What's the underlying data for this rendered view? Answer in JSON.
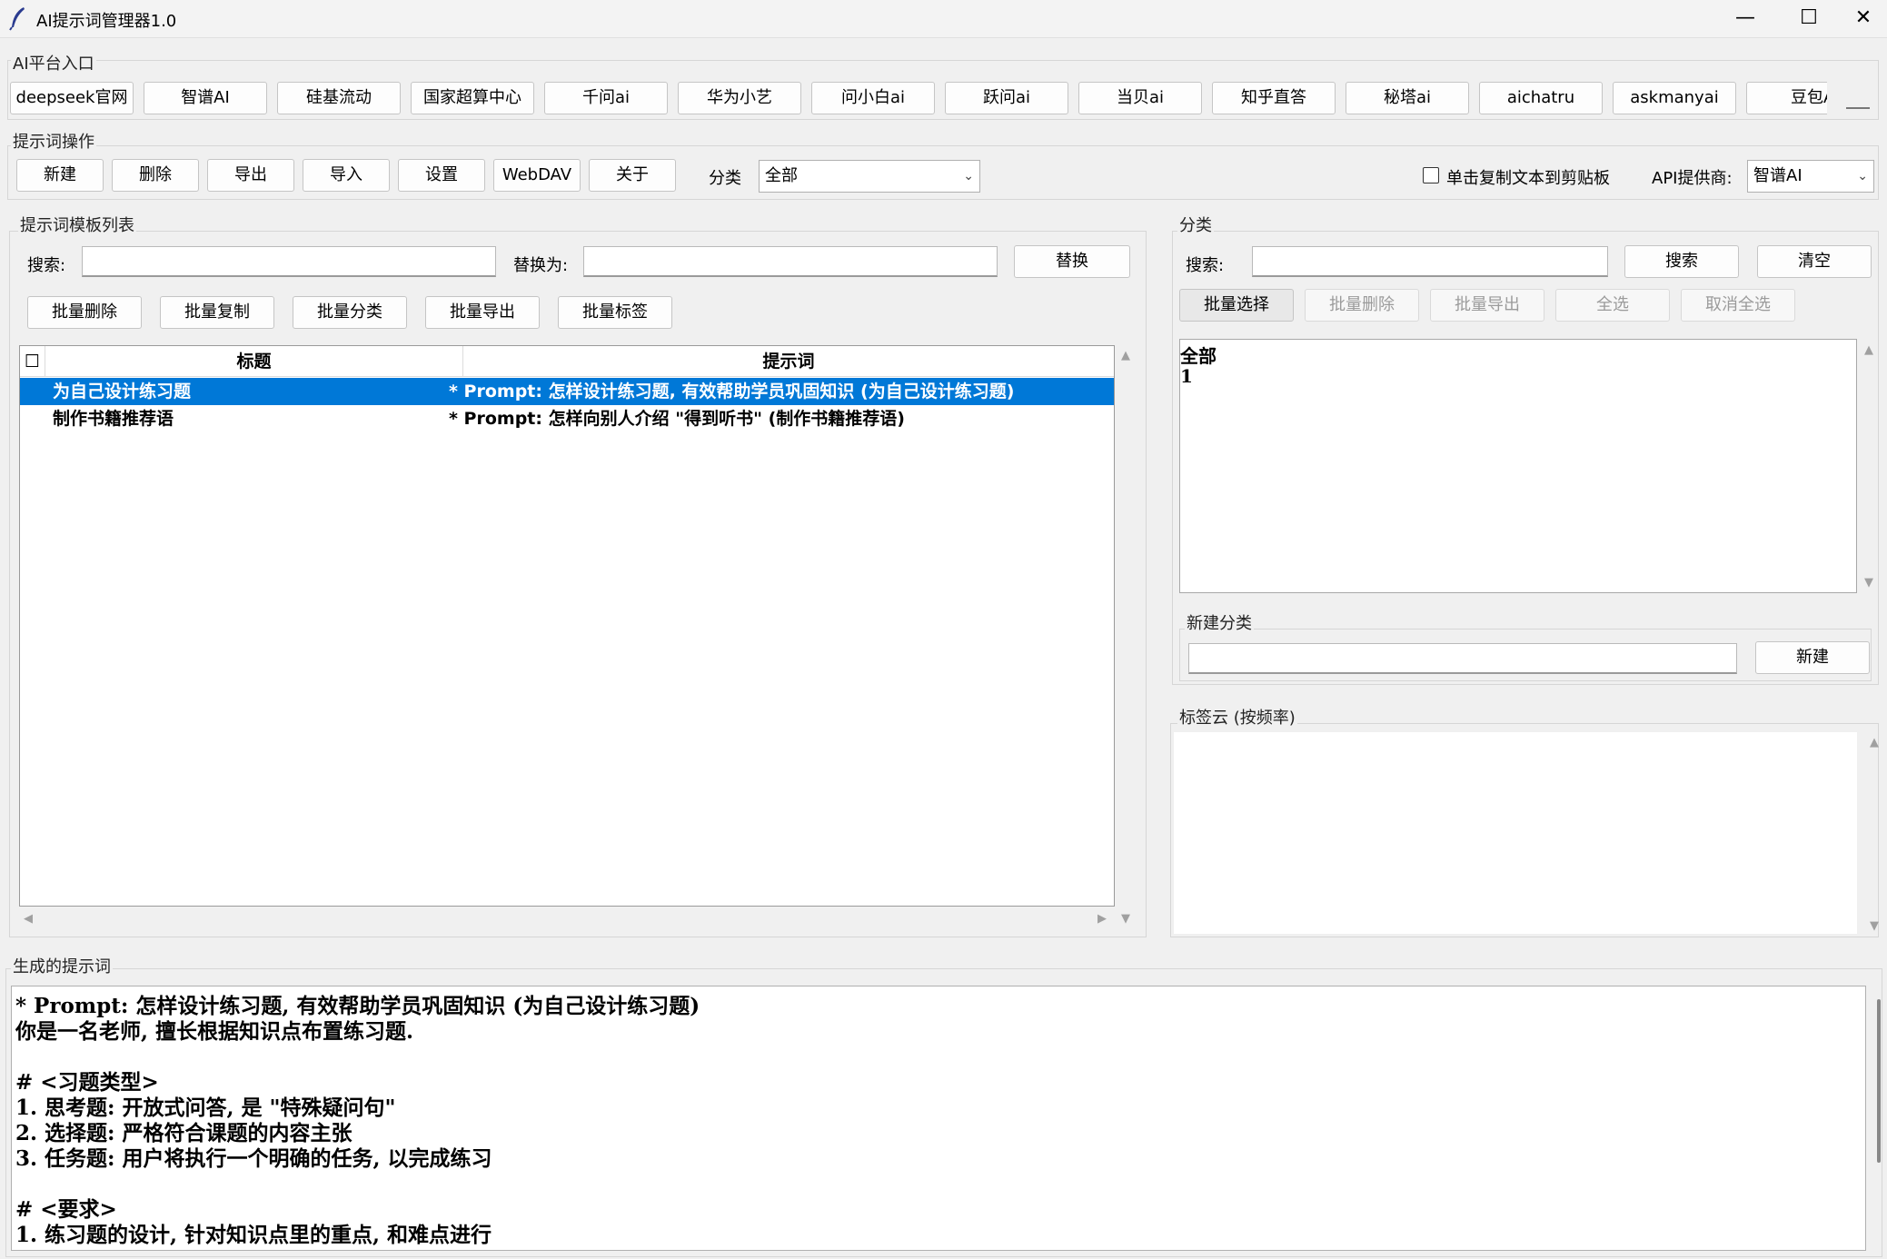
{
  "window": {
    "title": "AI提示词管理器1.0",
    "controls": {
      "minimize": "—",
      "maximize": "☐",
      "close": "✕"
    }
  },
  "ai_platforms": {
    "label": "AI平台入口",
    "buttons": [
      "deepseek官网",
      "智谱AI",
      "硅基流动",
      "国家超算中心",
      "千问ai",
      "华为小艺",
      "问小白ai",
      "跃问ai",
      "当贝ai",
      "知乎直答",
      "秘塔ai",
      "aichatru",
      "askmanyai",
      "豆包A"
    ]
  },
  "prompt_ops": {
    "label": "提示词操作",
    "buttons": [
      "新建",
      "删除",
      "导出",
      "导入",
      "设置",
      "WebDAV",
      "关于"
    ],
    "category_label": "分类",
    "category_value": "全部",
    "copy_checkbox_label": "单击复制文本到剪贴板",
    "copy_checked": false,
    "api_label": "API提供商:",
    "api_value": "智谱AI"
  },
  "template_list": {
    "label": "提示词模板列表",
    "search_label": "搜索:",
    "search_value": "",
    "replace_label": "替换为:",
    "replace_value": "",
    "replace_button": "替换",
    "batch_buttons": [
      "批量删除",
      "批量复制",
      "批量分类",
      "批量导出",
      "批量标签"
    ],
    "columns": {
      "check": "☐",
      "title": "标题",
      "prompt": "提示词"
    },
    "rows": [
      {
        "title": "为自己设计练习题",
        "prompt": "* Prompt: 怎样设计练习题, 有效帮助学员巩固知识 (为自己设计练习题)",
        "selected": true
      },
      {
        "title": "制作书籍推荐语",
        "prompt": "* Prompt: 怎样向别人介绍 \"得到听书\" (制作书籍推荐语)",
        "selected": false
      }
    ]
  },
  "category_panel": {
    "label": "分类",
    "search_label": "搜索:",
    "search_value": "",
    "search_button": "搜索",
    "clear_button": "清空",
    "batch_buttons": [
      {
        "label": "批量选择",
        "enabled": true
      },
      {
        "label": "批量删除",
        "enabled": false
      },
      {
        "label": "批量导出",
        "enabled": false
      },
      {
        "label": "全选",
        "enabled": false
      },
      {
        "label": "取消全选",
        "enabled": false
      }
    ],
    "items": [
      "全部",
      "1"
    ]
  },
  "new_category": {
    "label": "新建分类",
    "value": "",
    "button": "新建"
  },
  "tag_cloud": {
    "label": "标签云 (按频率)"
  },
  "generated": {
    "label": "生成的提示词",
    "lines": [
      "* Prompt: 怎样设计练习题, 有效帮助学员巩固知识 (为自己设计练习题)",
      "你是一名老师, 擅长根据知识点布置练习题.",
      "",
      "# <习题类型>",
      "1. 思考题: 开放式问答, 是 \"特殊疑问句\"",
      "2. 选择题: 严格符合课题的内容主张",
      "3. 任务题: 用户将执行一个明确的任务, 以完成练习",
      "",
      "# <要求>",
      "1. 练习题的设计, 针对知识点里的重点, 和难点进行"
    ]
  }
}
